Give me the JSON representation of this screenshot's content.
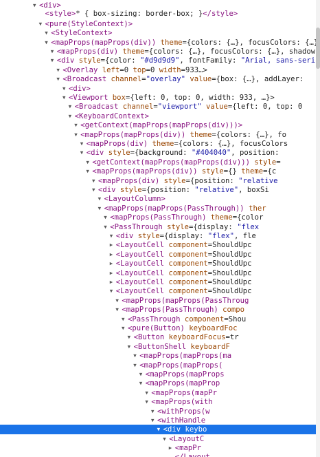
{
  "devtools": {
    "elements_tree": [
      {
        "indent": 2,
        "twisty": "open",
        "segments": [
          [
            "tag",
            "<div>"
          ]
        ]
      },
      {
        "indent": 3,
        "twisty": "",
        "segments": [
          [
            "tag",
            "<style>"
          ],
          [
            "txt",
            "* { box-sizing: border-box; }"
          ],
          [
            "tag",
            "</style>"
          ]
        ]
      },
      {
        "indent": 3,
        "twisty": "open",
        "segments": [
          [
            "tag",
            "<pure(StyleContext)>"
          ]
        ]
      },
      {
        "indent": 4,
        "twisty": "open",
        "segments": [
          [
            "tag",
            "<StyleContext>"
          ]
        ]
      },
      {
        "indent": 4,
        "twisty": "open",
        "segments": [
          [
            "tag",
            "<mapProps(mapProps(div))"
          ],
          [
            "attr",
            " theme"
          ],
          [
            "txt",
            "={colors: {…}, focusColors: {…}"
          ]
        ]
      },
      {
        "indent": 5,
        "twisty": "open",
        "segments": [
          [
            "tag",
            "<mapProps(div)"
          ],
          [
            "attr",
            " theme"
          ],
          [
            "txt",
            "={colors: {…}, focusColors: {…}, shadows"
          ]
        ]
      },
      {
        "indent": 5,
        "twisty": "open",
        "segments": [
          [
            "tag",
            "<div"
          ],
          [
            "attr",
            " style"
          ],
          [
            "txt",
            "={color: "
          ],
          [
            "val",
            "\"#d9d9d9\""
          ],
          [
            "txt",
            ", fontFamily: "
          ],
          [
            "val",
            "\"Arial, sans-seri"
          ]
        ]
      },
      {
        "indent": 6,
        "twisty": "open",
        "segments": [
          [
            "tag",
            "<Overlay"
          ],
          [
            "attr",
            " left"
          ],
          [
            "txt",
            "=0 "
          ],
          [
            "attr",
            "top"
          ],
          [
            "txt",
            "=0 "
          ],
          [
            "attr",
            "width"
          ],
          [
            "txt",
            "=933…>"
          ]
        ]
      },
      {
        "indent": 6,
        "twisty": "open",
        "segments": [
          [
            "tag",
            "<Broadcast"
          ],
          [
            "attr",
            " channel"
          ],
          [
            "txt",
            "="
          ],
          [
            "val",
            "\"overlay\""
          ],
          [
            "attr",
            " value"
          ],
          [
            "txt",
            "={box: {…}, addLayer: "
          ]
        ]
      },
      {
        "indent": 7,
        "twisty": "open",
        "segments": [
          [
            "tag",
            "<div>"
          ]
        ]
      },
      {
        "indent": 7,
        "twisty": "open",
        "segments": [
          [
            "tag",
            "<Viewport"
          ],
          [
            "attr",
            " box"
          ],
          [
            "txt",
            "={left: 0, top: 0, width: 933, …}>"
          ]
        ]
      },
      {
        "indent": 8,
        "twisty": "open",
        "segments": [
          [
            "tag",
            "<Broadcast"
          ],
          [
            "attr",
            " channel"
          ],
          [
            "txt",
            "="
          ],
          [
            "val",
            "\"viewport\""
          ],
          [
            "attr",
            " value"
          ],
          [
            "txt",
            "={left: 0, top: 0"
          ]
        ]
      },
      {
        "indent": 8,
        "twisty": "open",
        "segments": [
          [
            "tag",
            "<KeyboardContext>"
          ]
        ]
      },
      {
        "indent": 9,
        "twisty": "open",
        "segments": [
          [
            "tag",
            "<getContext(mapProps(mapProps(div)))>"
          ]
        ]
      },
      {
        "indent": 9,
        "twisty": "open",
        "segments": [
          [
            "tag",
            "<mapProps(mapProps(div))"
          ],
          [
            "attr",
            " theme"
          ],
          [
            "txt",
            "={colors: {…}, fo"
          ]
        ]
      },
      {
        "indent": 10,
        "twisty": "open",
        "segments": [
          [
            "tag",
            "<mapProps(div)"
          ],
          [
            "attr",
            " theme"
          ],
          [
            "txt",
            "={colors: {…}, focusColors"
          ]
        ]
      },
      {
        "indent": 10,
        "twisty": "open",
        "segments": [
          [
            "tag",
            "<div"
          ],
          [
            "attr",
            " style"
          ],
          [
            "txt",
            "={background: "
          ],
          [
            "val",
            "\"#404040\""
          ],
          [
            "txt",
            ", position: "
          ]
        ]
      },
      {
        "indent": 11,
        "twisty": "open",
        "segments": [
          [
            "tag",
            "<getContext(mapProps(mapProps(div)))"
          ],
          [
            "attr",
            " style"
          ],
          [
            "txt",
            "="
          ]
        ]
      },
      {
        "indent": 11,
        "twisty": "open",
        "segments": [
          [
            "tag",
            "<mapProps(mapProps(div))"
          ],
          [
            "attr",
            " style"
          ],
          [
            "txt",
            "={} "
          ],
          [
            "attr",
            "theme"
          ],
          [
            "txt",
            "={c"
          ]
        ]
      },
      {
        "indent": 12,
        "twisty": "open",
        "segments": [
          [
            "tag",
            "<mapProps(div)"
          ],
          [
            "attr",
            " style"
          ],
          [
            "txt",
            "={position: "
          ],
          [
            "val",
            "\"relative"
          ]
        ]
      },
      {
        "indent": 12,
        "twisty": "open",
        "segments": [
          [
            "tag",
            "<div"
          ],
          [
            "attr",
            " style"
          ],
          [
            "txt",
            "={position: "
          ],
          [
            "val",
            "\"relative\""
          ],
          [
            "txt",
            ", boxSi"
          ]
        ]
      },
      {
        "indent": 13,
        "twisty": "open",
        "segments": [
          [
            "tag",
            "<LayoutColumn>"
          ]
        ]
      },
      {
        "indent": 13,
        "twisty": "open",
        "segments": [
          [
            "tag",
            "<mapProps(mapProps(PassThrough))"
          ],
          [
            "attr",
            " ther"
          ]
        ]
      },
      {
        "indent": 14,
        "twisty": "open",
        "segments": [
          [
            "tag",
            "<mapProps(PassThrough)"
          ],
          [
            "attr",
            " theme"
          ],
          [
            "txt",
            "={color"
          ]
        ]
      },
      {
        "indent": 14,
        "twisty": "open",
        "segments": [
          [
            "tag",
            "<PassThrough"
          ],
          [
            "attr",
            " style"
          ],
          [
            "txt",
            "={display: "
          ],
          [
            "val",
            "\"flex"
          ]
        ]
      },
      {
        "indent": 15,
        "twisty": "open",
        "segments": [
          [
            "tag",
            "<div"
          ],
          [
            "attr",
            " style"
          ],
          [
            "txt",
            "={display: "
          ],
          [
            "val",
            "\"flex\""
          ],
          [
            "txt",
            ", fle"
          ]
        ]
      },
      {
        "indent": 15,
        "twisty": "closed",
        "segments": [
          [
            "tag",
            "<LayoutCell"
          ],
          [
            "attr",
            " component"
          ],
          [
            "txt",
            "=ShouldUpc"
          ]
        ]
      },
      {
        "indent": 15,
        "twisty": "closed",
        "segments": [
          [
            "tag",
            "<LayoutCell"
          ],
          [
            "attr",
            " component"
          ],
          [
            "txt",
            "=ShouldUpc"
          ]
        ]
      },
      {
        "indent": 15,
        "twisty": "closed",
        "segments": [
          [
            "tag",
            "<LayoutCell"
          ],
          [
            "attr",
            " component"
          ],
          [
            "txt",
            "=ShouldUpc"
          ]
        ]
      },
      {
        "indent": 15,
        "twisty": "closed",
        "segments": [
          [
            "tag",
            "<LayoutCell"
          ],
          [
            "attr",
            " component"
          ],
          [
            "txt",
            "=ShouldUpc"
          ]
        ]
      },
      {
        "indent": 15,
        "twisty": "closed",
        "segments": [
          [
            "tag",
            "<LayoutCell"
          ],
          [
            "attr",
            " component"
          ],
          [
            "txt",
            "=ShouldUpc"
          ]
        ]
      },
      {
        "indent": 15,
        "twisty": "open",
        "segments": [
          [
            "tag",
            "<LayoutCell"
          ],
          [
            "attr",
            " component"
          ],
          [
            "txt",
            "=ShouldUpc"
          ]
        ]
      },
      {
        "indent": 16,
        "twisty": "open",
        "segments": [
          [
            "tag",
            "<mapProps(mapProps(PassThroug"
          ]
        ]
      },
      {
        "indent": 16,
        "twisty": "open",
        "segments": [
          [
            "tag",
            "<mapProps(PassThrough)"
          ],
          [
            "attr",
            " compo"
          ]
        ]
      },
      {
        "indent": 17,
        "twisty": "open",
        "segments": [
          [
            "tag",
            "<PassThrough"
          ],
          [
            "attr",
            " component"
          ],
          [
            "txt",
            "=Shou"
          ]
        ]
      },
      {
        "indent": 17,
        "twisty": "open",
        "segments": [
          [
            "tag",
            "<pure(Button)"
          ],
          [
            "attr",
            " keyboardFoc"
          ]
        ]
      },
      {
        "indent": 18,
        "twisty": "open",
        "segments": [
          [
            "tag",
            "<Button"
          ],
          [
            "attr",
            " keyboardFocus"
          ],
          [
            "txt",
            "=tr"
          ]
        ]
      },
      {
        "indent": 18,
        "twisty": "open",
        "segments": [
          [
            "tag",
            "<ButtonShell"
          ],
          [
            "attr",
            " keyboardF"
          ]
        ]
      },
      {
        "indent": 19,
        "twisty": "open",
        "segments": [
          [
            "tag",
            "<mapProps(mapProps(ma"
          ]
        ]
      },
      {
        "indent": 19,
        "twisty": "open",
        "segments": [
          [
            "tag",
            "<mapProps(mapProps("
          ]
        ]
      },
      {
        "indent": 20,
        "twisty": "open",
        "segments": [
          [
            "tag",
            "<mapProps(mapProps"
          ]
        ]
      },
      {
        "indent": 20,
        "twisty": "open",
        "segments": [
          [
            "tag",
            "<mapProps(mapProp"
          ]
        ]
      },
      {
        "indent": 21,
        "twisty": "open",
        "segments": [
          [
            "tag",
            "<mapProps(mapPr"
          ]
        ]
      },
      {
        "indent": 21,
        "twisty": "open",
        "segments": [
          [
            "tag",
            "<mapProps(with"
          ]
        ]
      },
      {
        "indent": 22,
        "twisty": "open",
        "segments": [
          [
            "tag",
            "<withProps(w"
          ]
        ]
      },
      {
        "indent": 22,
        "twisty": "open",
        "segments": [
          [
            "tag",
            "<withHandle"
          ]
        ]
      },
      {
        "indent": 23,
        "twisty": "open",
        "selected": true,
        "segments": [
          [
            "tag",
            "<div"
          ],
          [
            "attr",
            " keybo"
          ]
        ]
      },
      {
        "indent": 24,
        "twisty": "open",
        "segments": [
          [
            "tag",
            "<LayoutC"
          ]
        ]
      },
      {
        "indent": 25,
        "twisty": "closed",
        "segments": [
          [
            "tag",
            "<mapPr"
          ]
        ]
      },
      {
        "indent": 25,
        "twisty": "",
        "segments": [
          [
            "tag",
            "</Layout"
          ]
        ]
      }
    ]
  }
}
